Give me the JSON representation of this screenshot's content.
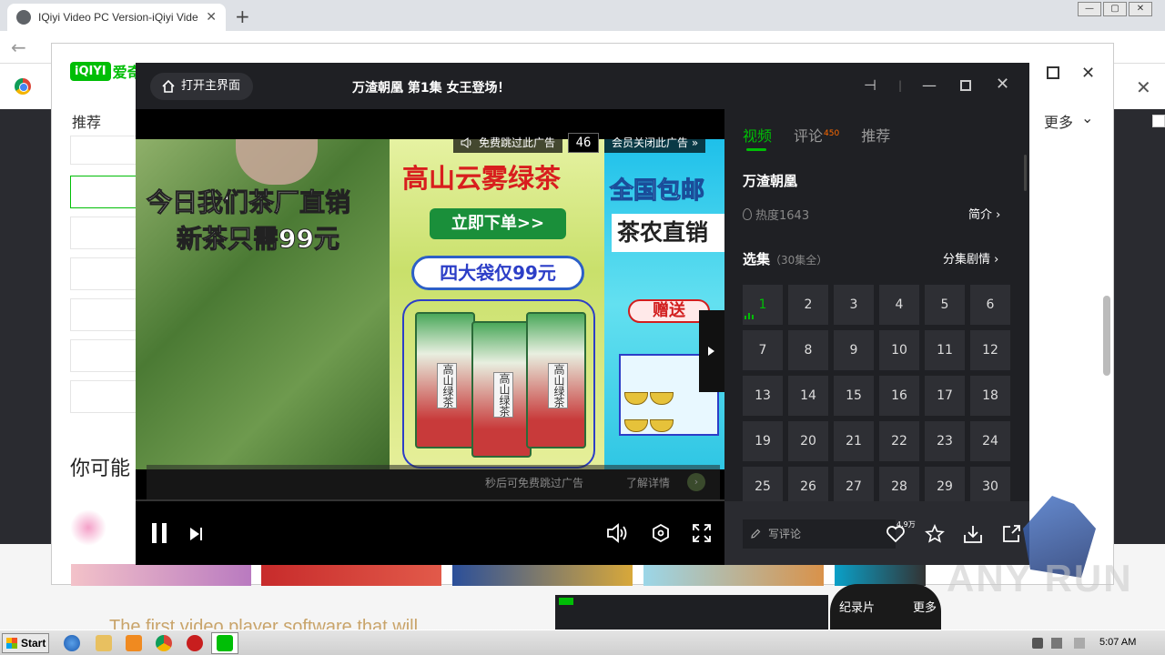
{
  "browser": {
    "tab_title": "IQiyi Video PC Version-iQiyi Video Of",
    "tab_close": "✕",
    "new_tab": "+",
    "win_min": "—",
    "win_max": "▢",
    "win_close": "✕",
    "back": "←",
    "bookmark_close": "✕"
  },
  "client": {
    "logo_mark": "iQIYI",
    "logo_text": "爱奇",
    "recommend": "推荐",
    "more": "更多",
    "more_chevron": "⌄",
    "close": "✕",
    "you_may": "你可能",
    "tagline": "The first video player software that will"
  },
  "player": {
    "home_label": "打开主界面",
    "title": "万渣朝凰 第1集 女王登场！",
    "pin": "⊣",
    "separator": "|",
    "minimize": "—",
    "close": "✕",
    "ad": {
      "skip_free": "免费跳过此广告",
      "countdown": "46",
      "vip_close": "会员关闭此广告 »",
      "left_line1": "今日我们茶厂直销",
      "left_line2": "新茶只需99元",
      "mid_headline": "高山云雾绿茶",
      "mid_order": "立即下单>>",
      "mid_price": "四大袋仅99元",
      "pack_label": "高山绿茶",
      "right_line1": "全国包邮",
      "right_line2": "茶农直销",
      "right_gift": "赠送",
      "skip_later": "秒后可免费跳过广告",
      "learn_more": "了解详情",
      "learn_arrow": "›"
    }
  },
  "panel": {
    "tabs": [
      {
        "label": "视频",
        "active": true
      },
      {
        "label": "评论",
        "badge": "450"
      },
      {
        "label": "推荐"
      }
    ],
    "show_name": "万渣朝凰",
    "heat": "热度1643",
    "intro": "简介 ›",
    "episodes_title": "选集",
    "episodes_count": "（30集全）",
    "plot": "分集剧情 ›",
    "current_episode": "1",
    "episodes": [
      "1",
      "2",
      "3",
      "4",
      "5",
      "6",
      "7",
      "8",
      "9",
      "10",
      "11",
      "12",
      "13",
      "14",
      "15",
      "16",
      "17",
      "18",
      "19",
      "20",
      "21",
      "22",
      "23",
      "24",
      "25",
      "26",
      "27",
      "28",
      "29",
      "30"
    ],
    "comment_placeholder": "写评论",
    "like_count": "4.9万"
  },
  "bottom": {
    "documentary": "纪录片",
    "more": "更多",
    "watermark": "ANY RUN"
  },
  "taskbar": {
    "start": "Start",
    "clock": "5:07 AM"
  },
  "colors": {
    "accent": "#00be06",
    "player_bg": "#1a1b1e",
    "panel_bg": "#1f2024",
    "badge": "#ff6a00"
  }
}
